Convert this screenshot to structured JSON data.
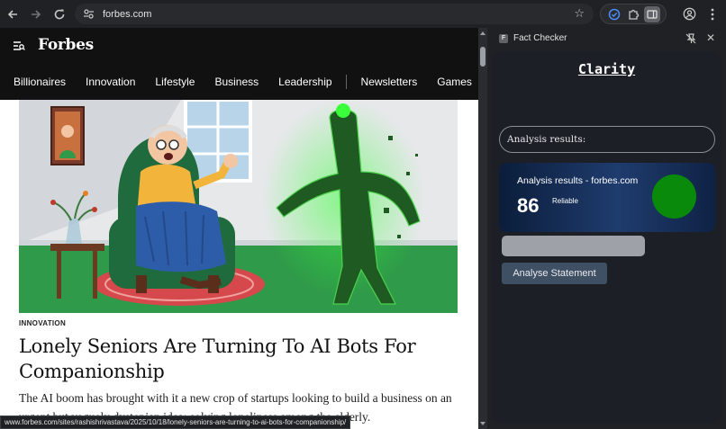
{
  "browser": {
    "url": "forbes.com",
    "nav_icons": [
      "back-arrow-icon",
      "forward-arrow-icon",
      "reload-icon"
    ],
    "omnibox_icon": "site-settings-icon",
    "star_icon": "bookmark-star-icon"
  },
  "forbes": {
    "logo": "Forbes",
    "nav": [
      "Billionaires",
      "Innovation",
      "Lifestyle",
      "Business",
      "Leadership",
      "Newsletters",
      "Games"
    ],
    "category": "INNOVATION",
    "headline": "Lonely Seniors Are Turning To AI Bots For Companionship",
    "dek": "The AI boom has brought with it a new crop of startups looking to build a business on an urgent but vaguely dystopian idea: solving loneliness among the elderly.",
    "status_url": "www.forbes.com/sites/rashishrivastava/2025/10/18/lonely-seniors-are-turning-to-ai-bots-for-companionship/"
  },
  "side_panel": {
    "favicon_letter": "F",
    "title": "Fact Checker",
    "app_title": "Clarity",
    "analysis_label": "Analysis results:",
    "card": {
      "title": "Analysis results - forbes.com",
      "score": "86",
      "rating": "Reliable",
      "indicator_color": "#0a8a0a"
    },
    "button": "Analyse Statement"
  },
  "colors": {
    "chrome_bg": "#202124",
    "forbes_bar": "#111111",
    "panel_bg": "#1c1f25",
    "card_gradient_mid": "#1f3c6e",
    "button_bg": "#3f4f64",
    "glow_green": "#3cff3c"
  }
}
